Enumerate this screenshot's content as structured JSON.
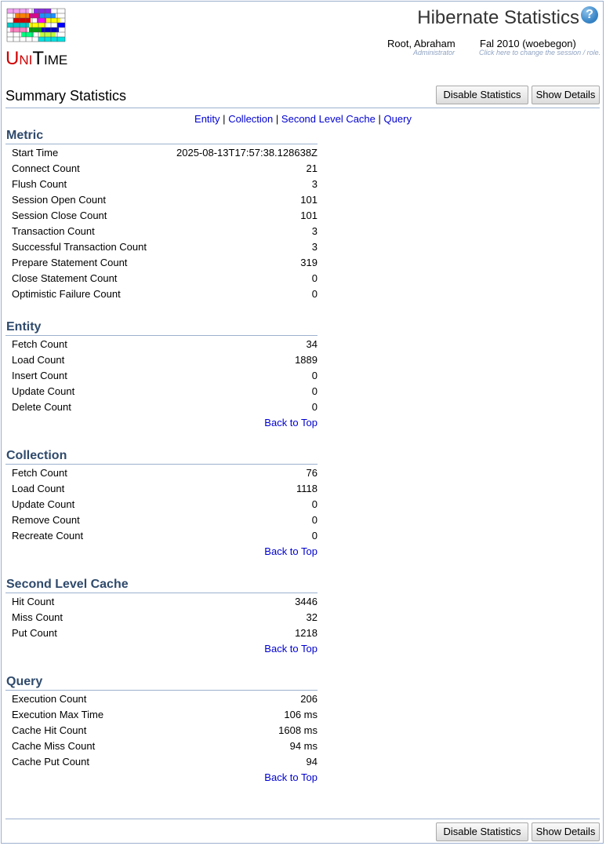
{
  "app": {
    "logo_text": "UniTime",
    "page_title": "Hibernate Statistics",
    "help_icon": "help-icon"
  },
  "user": {
    "name": "Root, Abraham",
    "role": "Administrator"
  },
  "session": {
    "name": "Fal 2010 (woebegon)",
    "hint": "Click here to change the session / role."
  },
  "summary": {
    "title": "Summary Statistics",
    "disable_label": "Disable Statistics",
    "details_label": "Show Details"
  },
  "nav": {
    "entity": "Entity",
    "collection": "Collection",
    "cache": "Second Level Cache",
    "query": "Query",
    "sep": "|"
  },
  "back_label": "Back to Top",
  "sections": {
    "metric": {
      "title": "Metric",
      "rows": [
        {
          "label": "Start Time",
          "value": "2025-08-13T17:57:38.128638Z"
        },
        {
          "label": "Connect Count",
          "value": "21"
        },
        {
          "label": "Flush Count",
          "value": "3"
        },
        {
          "label": "Session Open Count",
          "value": "101"
        },
        {
          "label": "Session Close Count",
          "value": "101"
        },
        {
          "label": "Transaction Count",
          "value": "3"
        },
        {
          "label": "Successful Transaction Count",
          "value": "3"
        },
        {
          "label": "Prepare Statement Count",
          "value": "319"
        },
        {
          "label": "Close Statement Count",
          "value": "0"
        },
        {
          "label": "Optimistic Failure Count",
          "value": "0"
        }
      ]
    },
    "entity": {
      "title": "Entity",
      "rows": [
        {
          "label": "Fetch Count",
          "value": "34"
        },
        {
          "label": "Load Count",
          "value": "1889"
        },
        {
          "label": "Insert Count",
          "value": "0"
        },
        {
          "label": "Update Count",
          "value": "0"
        },
        {
          "label": "Delete Count",
          "value": "0"
        }
      ]
    },
    "collection": {
      "title": "Collection",
      "rows": [
        {
          "label": "Fetch Count",
          "value": "76"
        },
        {
          "label": "Load Count",
          "value": "1118"
        },
        {
          "label": "Update Count",
          "value": "0"
        },
        {
          "label": "Remove Count",
          "value": "0"
        },
        {
          "label": "Recreate Count",
          "value": "0"
        }
      ]
    },
    "cache": {
      "title": "Second Level Cache",
      "rows": [
        {
          "label": "Hit Count",
          "value": "3446"
        },
        {
          "label": "Miss Count",
          "value": "32"
        },
        {
          "label": "Put Count",
          "value": "1218"
        }
      ]
    },
    "query": {
      "title": "Query",
      "rows": [
        {
          "label": "Execution Count",
          "value": "206"
        },
        {
          "label": "Execution Max Time",
          "value": "106 ms"
        },
        {
          "label": "Cache Hit Count",
          "value": "1608 ms"
        },
        {
          "label": "Cache Miss Count",
          "value": "94 ms"
        },
        {
          "label": "Cache Put Count",
          "value": "94"
        }
      ]
    }
  },
  "colors": {
    "section_title": "#2f4a6c",
    "link": "#0000d0",
    "rule": "#9cb0ce"
  }
}
